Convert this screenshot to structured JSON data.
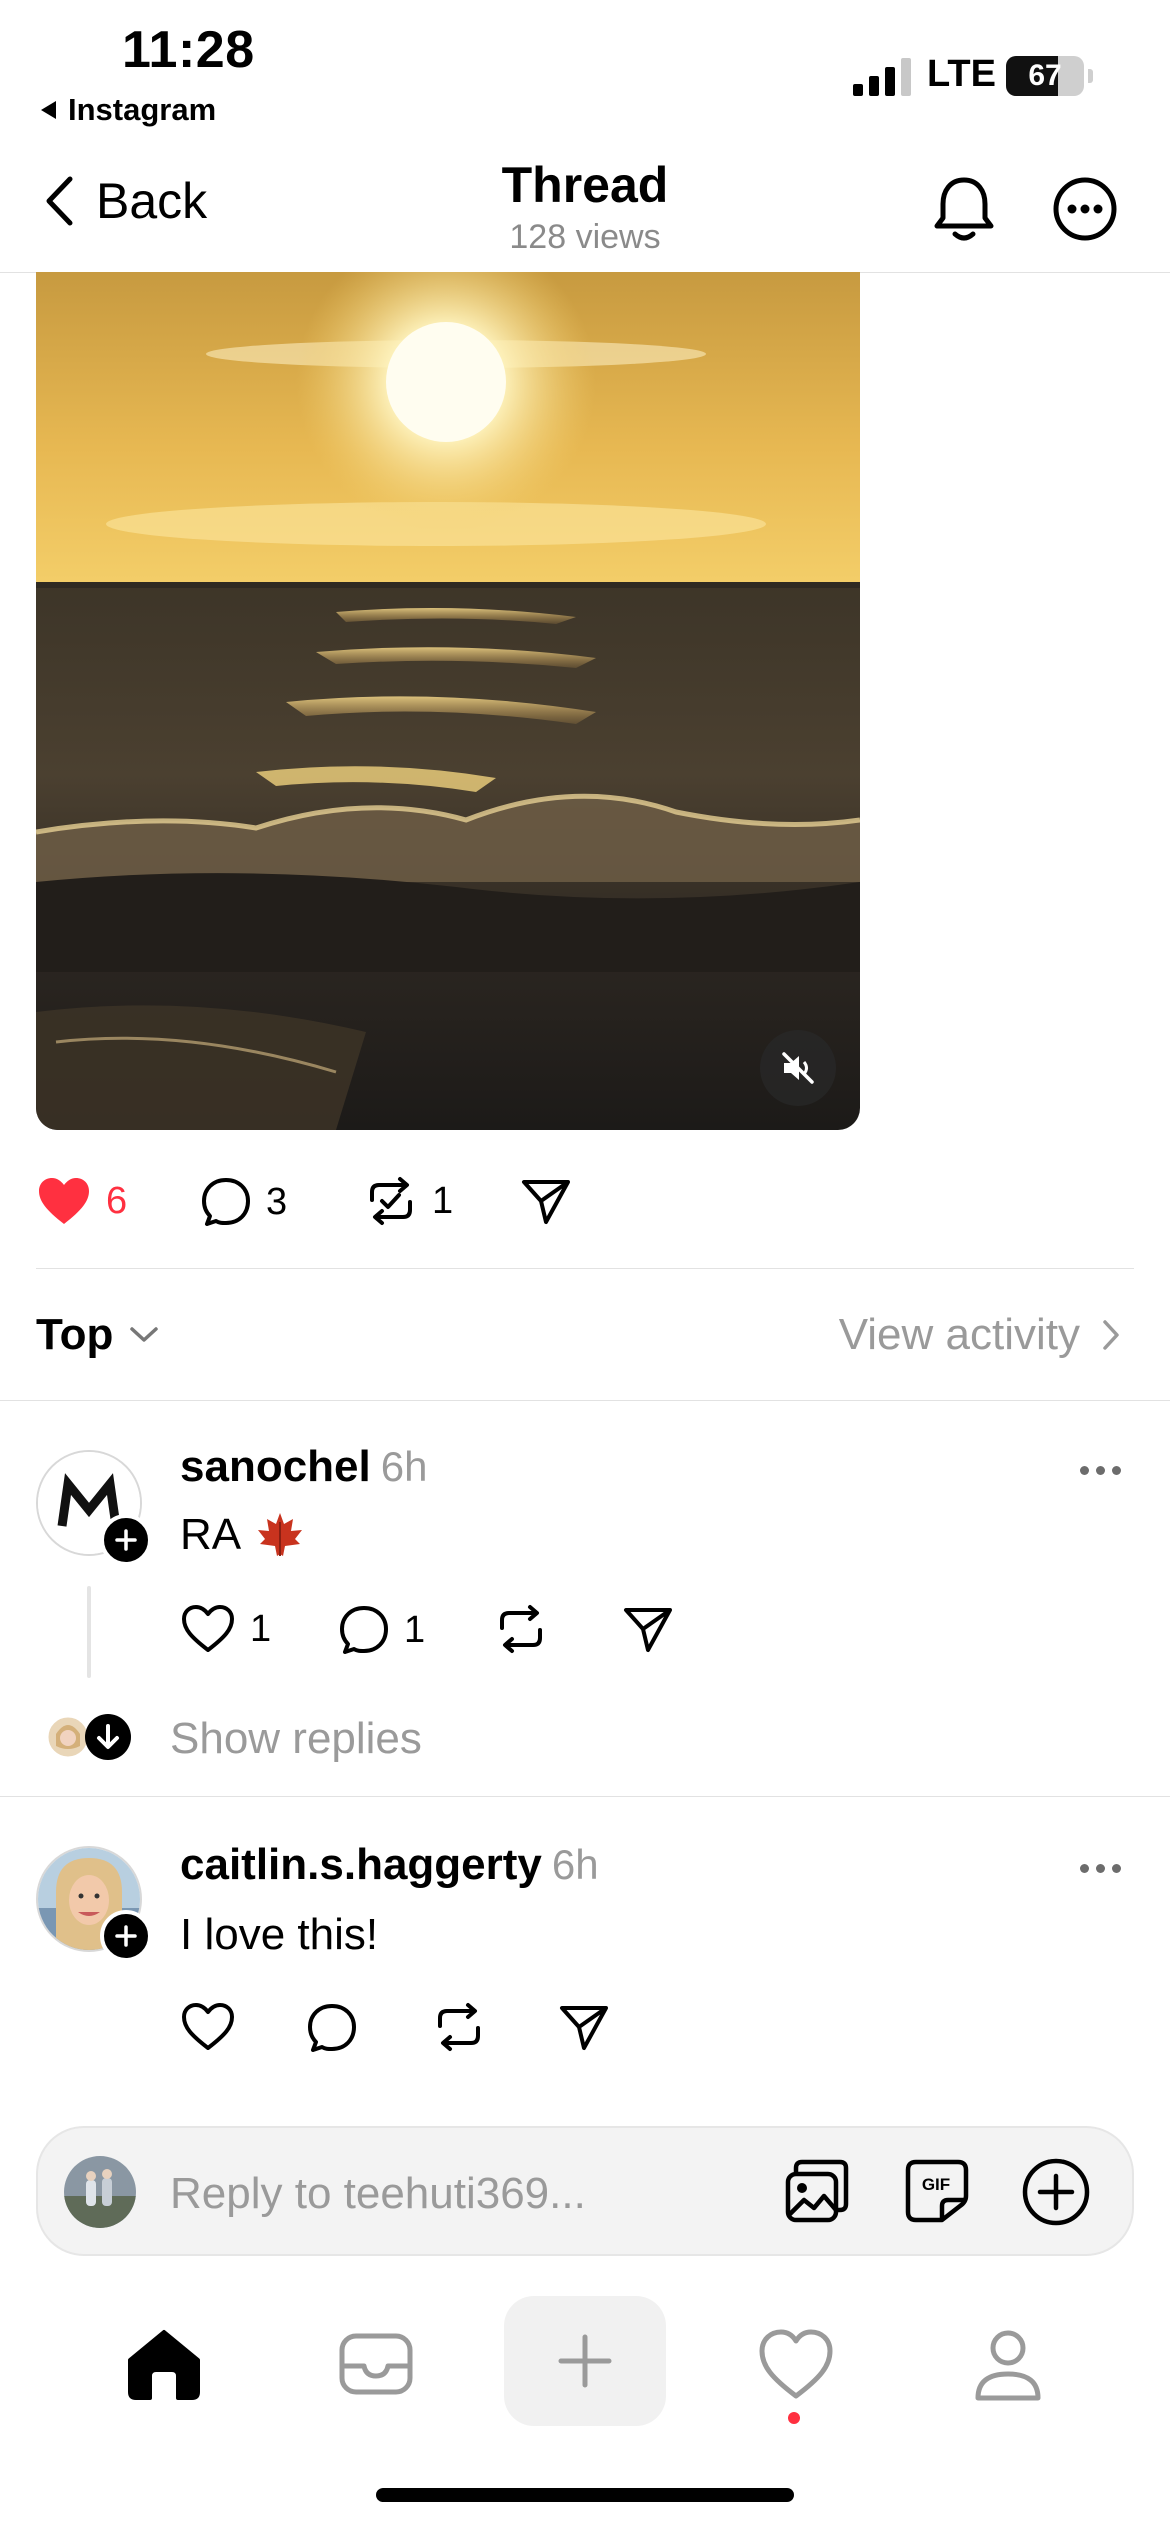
{
  "status_bar": {
    "time": "11:28",
    "back_app": "Instagram",
    "network": "LTE",
    "battery_level": "67",
    "battery_fraction": 0.67
  },
  "nav": {
    "back_label": "Back",
    "title": "Thread",
    "views": "128 views"
  },
  "post": {
    "likes": "6",
    "comments": "3",
    "reposts": "1",
    "liked": true
  },
  "sort": {
    "label": "Top",
    "view_activity": "View activity"
  },
  "replies": [
    {
      "username": "sanochel",
      "time": "6h",
      "text": "RA",
      "likes": "1",
      "comments": "1"
    },
    {
      "username": "caitlin.s.haggerty",
      "time": "6h",
      "text": "I love this!"
    }
  ],
  "show_replies": "Show replies",
  "composer": {
    "placeholder": "Reply to teehuti369..."
  },
  "colors": {
    "like_red": "#ff3040",
    "muted_gray": "#9a9a9a",
    "divider": "#e2e2e2"
  },
  "icons": [
    "back-chevron-icon",
    "bell-icon",
    "more-circle-icon",
    "mute-icon",
    "heart-icon",
    "comment-icon",
    "repost-icon",
    "share-icon",
    "chevron-down-icon",
    "chevron-right-icon",
    "ellipsis-icon",
    "plus-icon",
    "image-icon",
    "gif-icon",
    "home-icon",
    "inbox-icon",
    "person-icon"
  ]
}
